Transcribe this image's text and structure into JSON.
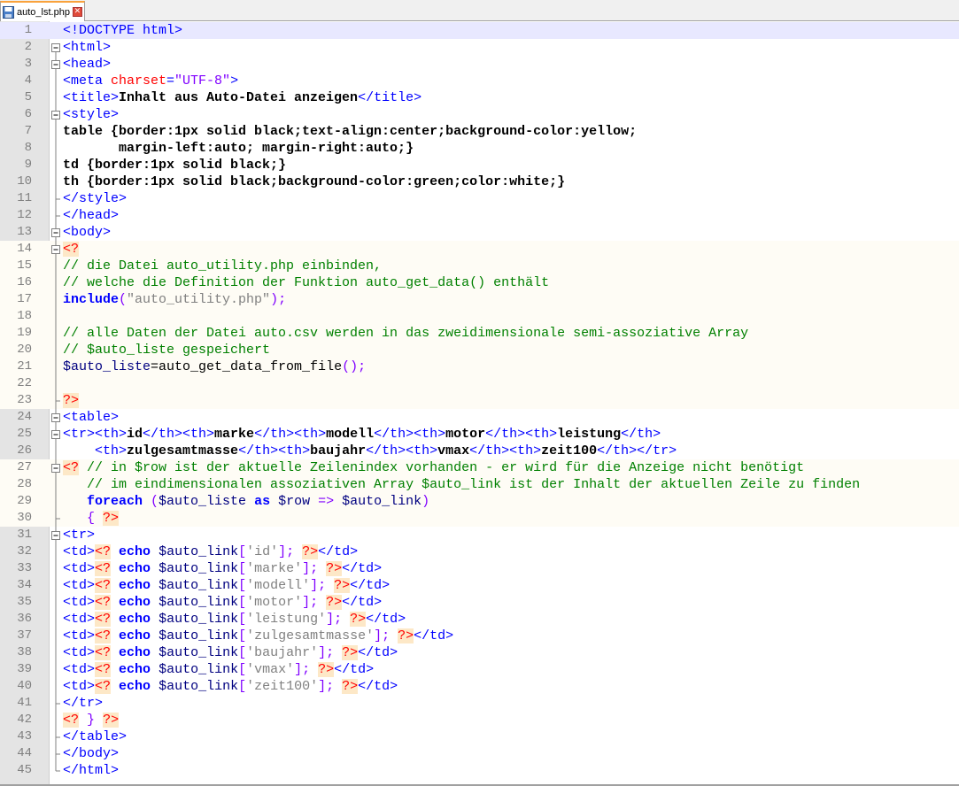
{
  "tab": {
    "filename": "auto_lst.php",
    "file_icon": "save-disk-icon",
    "close_icon": "close-icon"
  },
  "colors": {
    "current_line": "#e8e8ff",
    "php_block_bg": "#fefcf5",
    "tag": "#0000ff",
    "attribute": "#ff0000",
    "string": "#8000ff",
    "comment": "#008000",
    "keyword": "#0000ff",
    "php_tag_bg": "#fde8c7"
  },
  "lines": [
    {
      "n": "1",
      "p": [
        "<!DOCTYPE html>"
      ]
    },
    {
      "n": "2",
      "p": [
        "<html>"
      ]
    },
    {
      "n": "3",
      "p": [
        "<head>"
      ]
    },
    {
      "n": "4",
      "p": [
        "<meta",
        " charset",
        "=",
        "\"UTF-8\"",
        ">"
      ]
    },
    {
      "n": "5",
      "p": [
        "<title>",
        "Inhalt aus Auto-Datei anzeigen",
        "</title>"
      ]
    },
    {
      "n": "6",
      "p": [
        "<style>"
      ]
    },
    {
      "n": "7",
      "p": [
        "table {border:1px solid black;text-align:center;background-color:yellow;"
      ]
    },
    {
      "n": "8",
      "p": [
        "       margin-left:auto; margin-right:auto;}"
      ]
    },
    {
      "n": "9",
      "p": [
        "td {border:1px solid black;}"
      ]
    },
    {
      "n": "10",
      "p": [
        "th {border:1px solid black;background-color:green;color:white;}"
      ]
    },
    {
      "n": "11",
      "p": [
        "</style>"
      ]
    },
    {
      "n": "12",
      "p": [
        "</head>"
      ]
    },
    {
      "n": "13",
      "p": [
        "<body>"
      ]
    },
    {
      "n": "14",
      "p": [
        "<?"
      ]
    },
    {
      "n": "15",
      "p": [
        "// die Datei auto_utility.php einbinden,"
      ]
    },
    {
      "n": "16",
      "p": [
        "// welche die Definition der Funktion auto_get_data() enthält"
      ]
    },
    {
      "n": "17",
      "p": [
        "include",
        "(",
        "\"auto_utility.php\"",
        ");"
      ]
    },
    {
      "n": "18",
      "p": [
        ""
      ]
    },
    {
      "n": "19",
      "p": [
        "// alle Daten der Datei auto.csv werden in das zweidimensionale semi-assoziative Array"
      ]
    },
    {
      "n": "20",
      "p": [
        "// $auto_liste gespeichert"
      ]
    },
    {
      "n": "21",
      "p": [
        "$auto_liste",
        "=auto_get_data_from_file",
        "();"
      ]
    },
    {
      "n": "22",
      "p": [
        ""
      ]
    },
    {
      "n": "23",
      "p": [
        "?>"
      ]
    },
    {
      "n": "24",
      "p": [
        "<table>"
      ]
    },
    {
      "n": "25",
      "p": [
        "<tr><th>",
        "id",
        "</th><th>",
        "marke",
        "</th><th>",
        "modell",
        "</th><th>",
        "motor",
        "</th><th>",
        "leistung",
        "</th>"
      ]
    },
    {
      "n": "26",
      "p": [
        "    ",
        "<th>",
        "zulgesamtmasse",
        "</th><th>",
        "baujahr",
        "</th><th>",
        "vmax",
        "</th><th>",
        "zeit100",
        "</th></tr>"
      ]
    },
    {
      "n": "27",
      "p": [
        "<?",
        " // in $row ist der aktuelle Zeilenindex vorhanden - er wird für die Anzeige nicht benötigt"
      ]
    },
    {
      "n": "28",
      "p": [
        "   // im eindimensionalen assoziativen Array $auto_link ist der Inhalt der aktuellen Zeile zu finden"
      ]
    },
    {
      "n": "29",
      "p": [
        "   ",
        "foreach",
        " (",
        "$auto_liste",
        " ",
        "as",
        " ",
        "$row",
        " => ",
        "$auto_link",
        ")"
      ]
    },
    {
      "n": "30",
      "p": [
        "   ",
        "{",
        " ",
        "?>"
      ]
    },
    {
      "n": "31",
      "p": [
        "<tr>"
      ]
    },
    {
      "n": "32",
      "p": [
        "<td>",
        "<?",
        " ",
        "echo",
        " ",
        "$auto_link",
        "[",
        "'id'",
        "]; ",
        "?>",
        "</td>"
      ]
    },
    {
      "n": "33",
      "p": [
        "<td>",
        "<?",
        " ",
        "echo",
        " ",
        "$auto_link",
        "[",
        "'marke'",
        "]; ",
        "?>",
        "</td>"
      ]
    },
    {
      "n": "34",
      "p": [
        "<td>",
        "<?",
        " ",
        "echo",
        " ",
        "$auto_link",
        "[",
        "'modell'",
        "]; ",
        "?>",
        "</td>"
      ]
    },
    {
      "n": "35",
      "p": [
        "<td>",
        "<?",
        " ",
        "echo",
        " ",
        "$auto_link",
        "[",
        "'motor'",
        "]; ",
        "?>",
        "</td>"
      ]
    },
    {
      "n": "36",
      "p": [
        "<td>",
        "<?",
        " ",
        "echo",
        " ",
        "$auto_link",
        "[",
        "'leistung'",
        "]; ",
        "?>",
        "</td>"
      ]
    },
    {
      "n": "37",
      "p": [
        "<td>",
        "<?",
        " ",
        "echo",
        " ",
        "$auto_link",
        "[",
        "'zulgesamtmasse'",
        "]; ",
        "?>",
        "</td>"
      ]
    },
    {
      "n": "38",
      "p": [
        "<td>",
        "<?",
        " ",
        "echo",
        " ",
        "$auto_link",
        "[",
        "'baujahr'",
        "]; ",
        "?>",
        "</td>"
      ]
    },
    {
      "n": "39",
      "p": [
        "<td>",
        "<?",
        " ",
        "echo",
        " ",
        "$auto_link",
        "[",
        "'vmax'",
        "]; ",
        "?>",
        "</td>"
      ]
    },
    {
      "n": "40",
      "p": [
        "<td>",
        "<?",
        " ",
        "echo",
        " ",
        "$auto_link",
        "[",
        "'zeit100'",
        "]; ",
        "?>",
        "</td>"
      ]
    },
    {
      "n": "41",
      "p": [
        "</tr>"
      ]
    },
    {
      "n": "42",
      "p": [
        "<?",
        " ",
        "}",
        " ",
        "?>"
      ]
    },
    {
      "n": "43",
      "p": [
        "</table>"
      ]
    },
    {
      "n": "44",
      "p": [
        "</body>"
      ]
    },
    {
      "n": "45",
      "p": [
        "</html>"
      ]
    }
  ]
}
